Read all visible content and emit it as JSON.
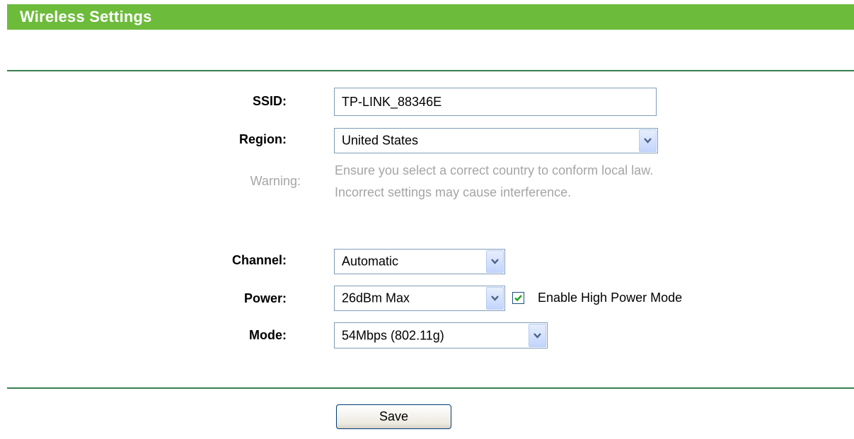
{
  "header": {
    "title": "Wireless Settings"
  },
  "form": {
    "ssid": {
      "label": "SSID:",
      "value": "TP-LINK_88346E"
    },
    "region": {
      "label": "Region:",
      "value": "United States"
    },
    "warning": {
      "label": "Warning:",
      "line1": "Ensure you select a correct country to conform local law.",
      "line2": "Incorrect settings may cause interference."
    },
    "channel": {
      "label": "Channel:",
      "value": "Automatic"
    },
    "power": {
      "label": "Power:",
      "value": "26dBm Max",
      "high_power_checkbox": {
        "label": "Enable High Power Mode",
        "checked": true
      }
    },
    "mode": {
      "label": "Mode:",
      "value": "54Mbps (802.11g)"
    }
  },
  "actions": {
    "save_label": "Save"
  },
  "colors": {
    "header_bg": "#6dbb3b",
    "divider": "#3a7e4e",
    "warning_text": "#a5a5a5",
    "input_border": "#7f9db9"
  }
}
